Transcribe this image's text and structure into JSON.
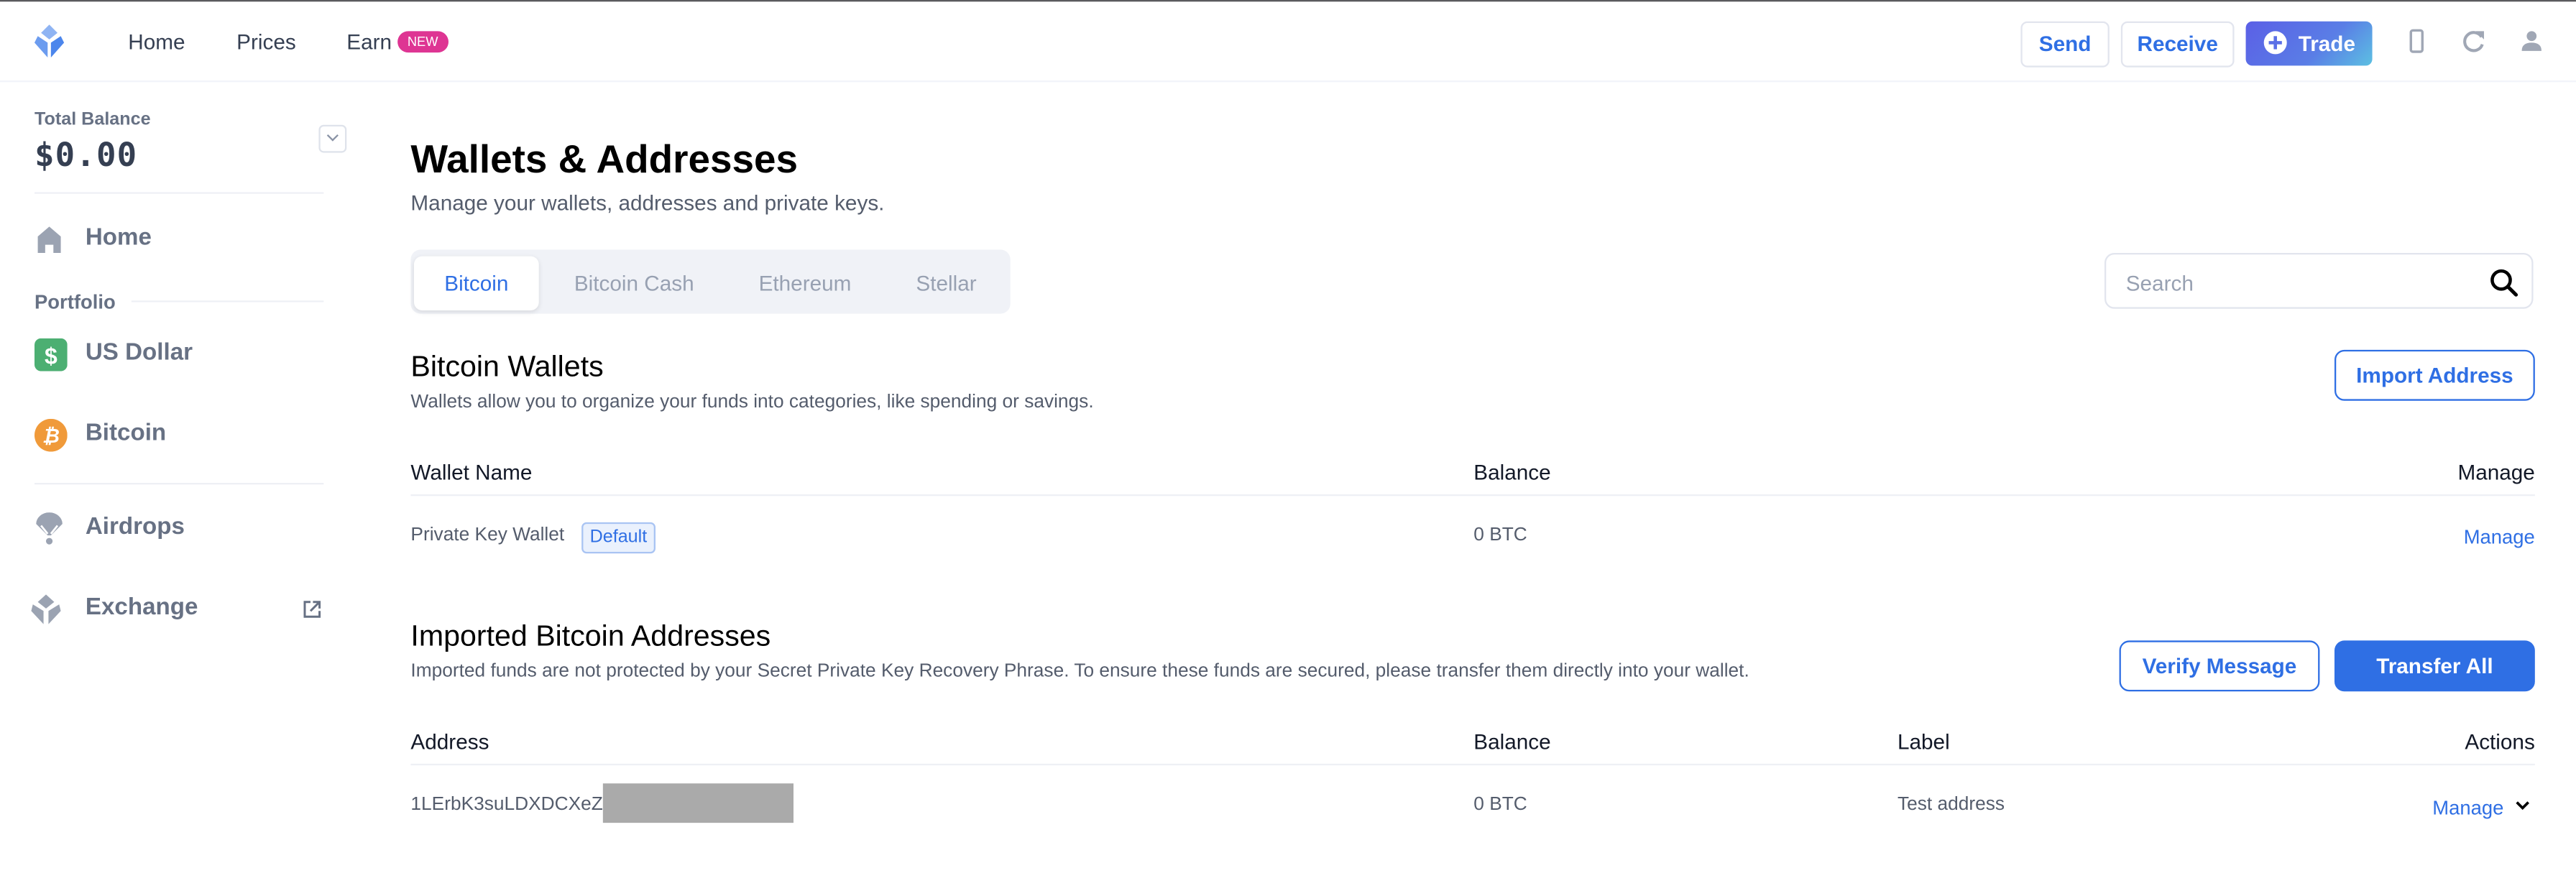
{
  "header": {
    "nav": [
      {
        "label": "Home"
      },
      {
        "label": "Prices"
      },
      {
        "label": "Earn",
        "badge": "NEW"
      }
    ],
    "buttons": {
      "send": "Send",
      "receive": "Receive",
      "trade": "Trade"
    },
    "icons": [
      "mobile-icon",
      "refresh-icon",
      "user-icon"
    ],
    "colors": {
      "accent": "#2f6fe4",
      "badge": "#de3593"
    }
  },
  "sidebar": {
    "total_balance_label": "Total Balance",
    "total_balance_value": "$0.00",
    "portfolio_label": "Portfolio",
    "items": [
      {
        "label": "Home",
        "icon": "home-icon"
      },
      {
        "label": "US Dollar",
        "icon": "dollar-icon",
        "color": "#4caf72"
      },
      {
        "label": "Bitcoin",
        "icon": "bitcoin-icon",
        "color": "#f09a3a"
      },
      {
        "label": "Airdrops",
        "icon": "parachute-icon"
      },
      {
        "label": "Exchange",
        "icon": "exchange-icon",
        "external": true
      }
    ]
  },
  "main": {
    "title": "Wallets & Addresses",
    "subtitle": "Manage your wallets, addresses and private keys.",
    "tabs": [
      {
        "label": "Bitcoin",
        "active": true
      },
      {
        "label": "Bitcoin Cash",
        "active": false
      },
      {
        "label": "Ethereum",
        "active": false
      },
      {
        "label": "Stellar",
        "active": false
      }
    ],
    "search": {
      "placeholder": "Search",
      "value": ""
    },
    "wallets": {
      "title": "Bitcoin Wallets",
      "description": "Wallets allow you to organize your funds into categories, like spending or savings.",
      "import_button": "Import Address",
      "columns": [
        "Wallet Name",
        "Balance",
        "Manage"
      ],
      "rows": [
        {
          "name": "Private Key Wallet",
          "badge": "Default",
          "balance": "0 BTC",
          "action": "Manage"
        }
      ]
    },
    "imported": {
      "title": "Imported Bitcoin Addresses",
      "description": "Imported funds are not protected by your Secret Private Key Recovery Phrase. To ensure these funds are secured, please transfer them directly into your wallet.",
      "verify_button": "Verify Message",
      "transfer_button": "Transfer All",
      "columns": [
        "Address",
        "Balance",
        "Label",
        "Actions"
      ],
      "rows": [
        {
          "address": "1LErbK3suLDXDCXeZ",
          "redacted": true,
          "balance": "0 BTC",
          "label": "Test address",
          "action": "Manage"
        }
      ]
    }
  }
}
